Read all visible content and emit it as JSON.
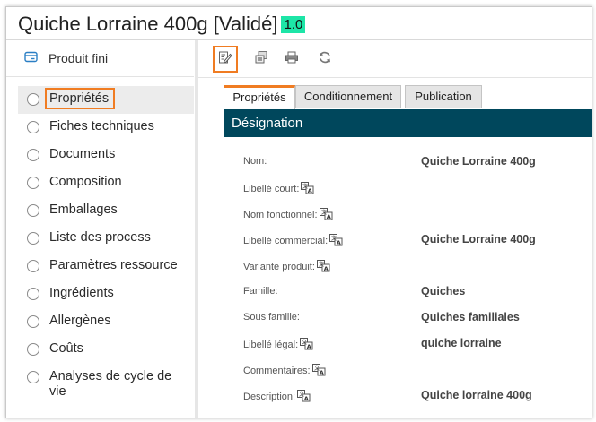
{
  "header": {
    "title": "Quiche Lorraine 400g [Validé]",
    "version": "1.0",
    "version_color": "#1de5a7"
  },
  "sidebar": {
    "product_type": "Produit fini",
    "product_icon": "card-icon",
    "items": [
      {
        "label": "Propriétés",
        "active": true
      },
      {
        "label": "Fiches techniques"
      },
      {
        "label": "Documents"
      },
      {
        "label": "Composition"
      },
      {
        "label": "Emballages"
      },
      {
        "label": "Liste des process"
      },
      {
        "label": "Paramètres ressource"
      },
      {
        "label": "Ingrédients"
      },
      {
        "label": "Allergènes"
      },
      {
        "label": "Coûts"
      },
      {
        "label": "Analyses de cycle de vie"
      }
    ]
  },
  "toolbar": {
    "icons": [
      "edit-icon",
      "copy-icon",
      "print-icon",
      "refresh-icon"
    ]
  },
  "tabs": [
    {
      "label": "Propriétés",
      "active": true
    },
    {
      "label": "Conditionnement"
    },
    {
      "label": "Publication"
    }
  ],
  "section": {
    "title": "Désignation",
    "color": "#00475c"
  },
  "fields": [
    {
      "label": "Nom:",
      "value": "Quiche Lorraine 400g",
      "translatable": false
    },
    {
      "label": "Libellé court:",
      "value": "",
      "translatable": true
    },
    {
      "label": "Nom fonctionnel:",
      "value": "",
      "translatable": true
    },
    {
      "label": "Libellé commercial:",
      "value": "Quiche Lorraine 400g",
      "translatable": true
    },
    {
      "label": "Variante produit:",
      "value": "",
      "translatable": true
    },
    {
      "label": "Famille:",
      "value": "Quiches",
      "translatable": false
    },
    {
      "label": "Sous famille:",
      "value": "Quiches familiales",
      "translatable": false
    },
    {
      "label": "Libellé légal:",
      "value": "quiche lorraine",
      "translatable": true
    },
    {
      "label": "Commentaires:",
      "value": "",
      "translatable": true
    },
    {
      "label": "Description:",
      "value": "Quiche lorraine 400g",
      "translatable": true
    }
  ],
  "highlight_color": "#f07c22"
}
